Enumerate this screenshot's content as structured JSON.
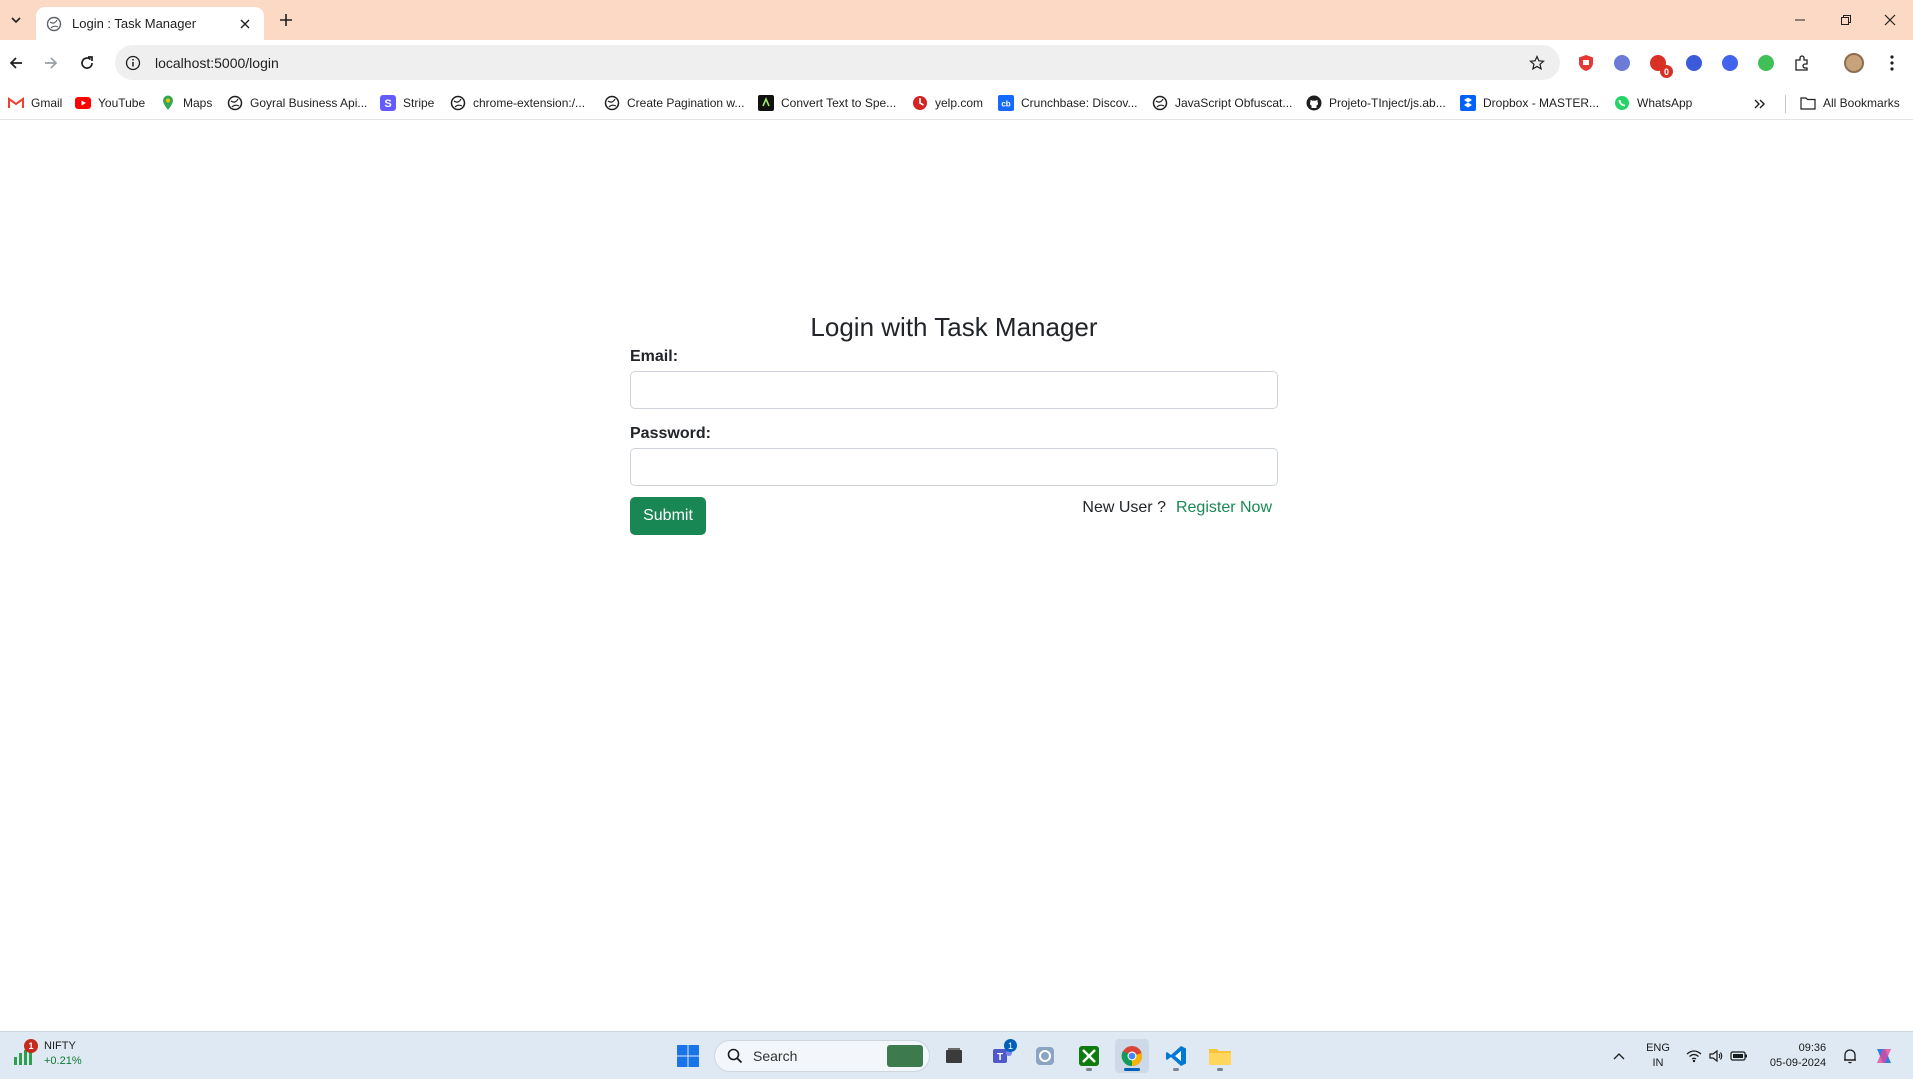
{
  "browser": {
    "tab": {
      "title": "Login : Task Manager"
    },
    "address_bar": {
      "url": "localhost:5000/login"
    },
    "bookmarks": [
      {
        "label": "Gmail",
        "icon": "gmail-icon"
      },
      {
        "label": "YouTube",
        "icon": "youtube-icon"
      },
      {
        "label": "Maps",
        "icon": "maps-icon"
      },
      {
        "label": "Goyral Business Api...",
        "icon": "globe-icon"
      },
      {
        "label": "Stripe",
        "icon": "stripe-icon"
      },
      {
        "label": "chrome-extension:/...",
        "icon": "globe-icon"
      },
      {
        "label": "Create Pagination w...",
        "icon": "globe-icon"
      },
      {
        "label": "Convert Text to Spe...",
        "icon": "speech-icon"
      },
      {
        "label": "yelp.com",
        "icon": "yelp-icon"
      },
      {
        "label": "Crunchbase: Discov...",
        "icon": "crunchbase-icon"
      },
      {
        "label": "JavaScript Obfuscat...",
        "icon": "globe-icon"
      },
      {
        "label": "Projeto-TInject/js.ab...",
        "icon": "github-icon"
      },
      {
        "label": "Dropbox - MASTER...",
        "icon": "dropbox-icon"
      },
      {
        "label": "WhatsApp",
        "icon": "whatsapp-icon"
      }
    ],
    "all_bookmarks_label": "All Bookmarks",
    "extension_badge": "0"
  },
  "login": {
    "title": "Login with Task Manager",
    "email_label": "Email:",
    "email_value": "",
    "password_label": "Password:",
    "password_value": "",
    "submit_label": "Submit",
    "new_user_text": "New User ?",
    "register_link": "Register Now"
  },
  "taskbar": {
    "widget_name": "NIFTY",
    "widget_change": "+0.21%",
    "widget_badge": "1",
    "search_placeholder": "Search",
    "teams_badge": "1",
    "language_line1": "ENG",
    "language_line2": "IN",
    "time": "09:36",
    "date": "05-09-2024"
  },
  "colors": {
    "tabstrip": "#fbd9c5",
    "primary_button": "#198754",
    "link": "#198754",
    "taskbar": "#dfe9f3"
  }
}
